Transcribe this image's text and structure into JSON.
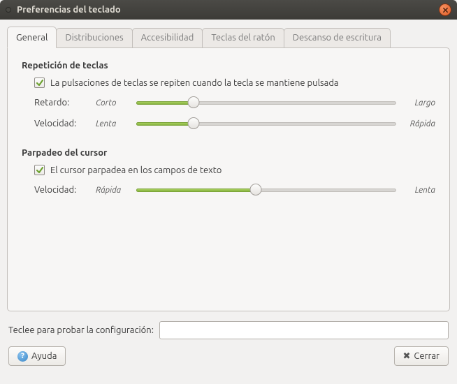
{
  "window": {
    "title": "Preferencias del teclado"
  },
  "tabs": {
    "general": "General",
    "distribuciones": "Distribuciones",
    "accesibilidad": "Accesibilidad",
    "teclas_raton": "Teclas del ratón",
    "descanso": "Descanso de escritura"
  },
  "repeat": {
    "title": "Repetición de teclas",
    "checkbox_label": "La pulsaciones de teclas se repiten cuando la tecla se mantiene pulsada",
    "delay_label": "Retardo:",
    "delay_min": "Corto",
    "delay_max": "Largo",
    "delay_value": 22,
    "speed_label": "Velocidad:",
    "speed_min": "Lenta",
    "speed_max": "Rápida",
    "speed_value": 22
  },
  "cursor": {
    "title": "Parpadeo del cursor",
    "checkbox_label": "El cursor parpadea en los campos de texto",
    "speed_label": "Velocidad:",
    "speed_min": "Rápida",
    "speed_max": "Lenta",
    "speed_value": 46
  },
  "test": {
    "label": "Teclee para probar la configuración:",
    "value": ""
  },
  "buttons": {
    "help": "Ayuda",
    "close": "Cerrar"
  }
}
